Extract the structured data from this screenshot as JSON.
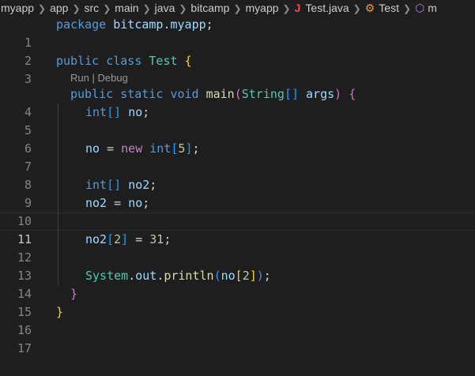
{
  "breadcrumb": [
    "myapp",
    "app",
    "src",
    "main",
    "java",
    "bitcamp",
    "myapp",
    "Test.java",
    "Test",
    "m"
  ],
  "icons": {
    "file": "java-file-icon",
    "class": "class-icon",
    "method": "method-icon",
    "separator": "chevron-right-icon"
  },
  "codelens": {
    "run": "Run",
    "divider": "|",
    "debug": "Debug"
  },
  "lines": [
    {
      "n": "1"
    },
    {
      "n": "2"
    },
    {
      "n": "3"
    },
    {
      "n": "4"
    },
    {
      "n": "5"
    },
    {
      "n": "6"
    },
    {
      "n": "7"
    },
    {
      "n": "8"
    },
    {
      "n": "9"
    },
    {
      "n": "10"
    },
    {
      "n": "11"
    },
    {
      "n": "12"
    },
    {
      "n": "13"
    },
    {
      "n": "14"
    },
    {
      "n": "15"
    },
    {
      "n": "16"
    },
    {
      "n": "17"
    }
  ],
  "code": {
    "l1": [
      "package",
      "bitcamp",
      ".",
      "myapp",
      ";"
    ],
    "l3": [
      "public",
      "class",
      "Test",
      "{"
    ],
    "l4": [
      "public",
      "static",
      "void",
      "main",
      "(",
      "String",
      "[]",
      "args",
      ")",
      "{"
    ],
    "l5": [
      "int",
      "[]",
      "no",
      ";"
    ],
    "l7": [
      "no",
      "=",
      "new",
      "int",
      "[",
      "5",
      "]",
      ";"
    ],
    "l9": [
      "int",
      "[]",
      "no2",
      ";"
    ],
    "l10": [
      "no2",
      "=",
      "no",
      ";"
    ],
    "l12": [
      "no2",
      "[",
      "2",
      "]",
      "=",
      "31",
      ";"
    ],
    "l14": [
      "System",
      ".",
      "out",
      ".",
      "println",
      "(",
      "no",
      "[",
      "2",
      "]",
      ")",
      ";"
    ],
    "l15": [
      "}"
    ],
    "l16": [
      "}"
    ]
  },
  "colors": {
    "background": "#1e1e1e",
    "keyword": "#569cd6",
    "type": "#4ec9b0",
    "variable": "#9cdcfe",
    "function": "#dcdcaa",
    "number": "#b5cea8",
    "bracket_gold": "#ffd700",
    "bracket_purple": "#da70d6",
    "bracket_blue": "#179fff"
  }
}
